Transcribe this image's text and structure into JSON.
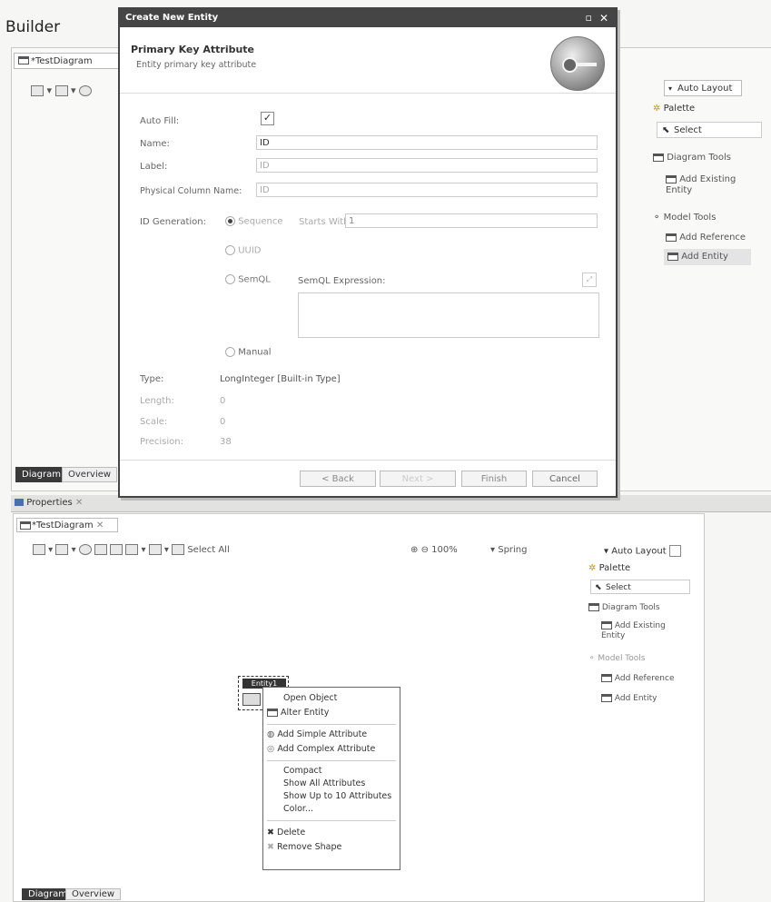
{
  "app": {
    "title": "Builder"
  },
  "upper_editor": {
    "tab_label": "*TestDiagram",
    "bottom_tabs": [
      "Diagram",
      "Overview"
    ],
    "palette": {
      "auto_layout": "Auto Layout",
      "header": "Palette",
      "select": "Select",
      "diagram_tools": "Diagram Tools",
      "add_existing_entity": "Add Existing Entity",
      "model_tools": "Model Tools",
      "add_reference": "Add Reference",
      "add_entity": "Add Entity"
    }
  },
  "properties_tab": {
    "label": "Properties"
  },
  "dialog": {
    "title": "Create New Entity",
    "header_title": "Primary Key Attribute",
    "header_subtitle": "Entity primary key attribute",
    "auto_fill_label": "Auto Fill:",
    "auto_fill_checked": true,
    "name_label": "Name:",
    "name_value": "ID",
    "label_label": "Label:",
    "label_value": "ID",
    "physical_label": "Physical Column Name:",
    "physical_value": "ID",
    "id_generation_label": "ID Generation:",
    "options": {
      "sequence": "Sequence",
      "starts_with_label": "Starts With:",
      "starts_with_value": "1",
      "uuid": "UUID",
      "semql": "SemQL",
      "semql_expression_label": "SemQL Expression:",
      "manual": "Manual"
    },
    "type_label": "Type:",
    "type_value": "LongInteger [Built-in Type]",
    "length_label": "Length:",
    "length_value": "0",
    "scale_label": "Scale:",
    "scale_value": "0",
    "precision_label": "Precision:",
    "precision_value": "38",
    "buttons": {
      "back": "< Back",
      "next": "Next >",
      "finish": "Finish",
      "cancel": "Cancel"
    }
  },
  "lower_editor": {
    "tab_label": "*TestDiagram",
    "toolbar": {
      "select_all": "Select All",
      "zoom": "100%",
      "layout": "Spring",
      "auto_layout": "Auto Layout"
    },
    "palette": {
      "header": "Palette",
      "select": "Select",
      "diagram_tools": "Diagram Tools",
      "add_existing_entity": "Add Existing Entity",
      "model_tools": "Model Tools",
      "add_reference": "Add Reference",
      "add_entity": "Add Entity"
    },
    "entity_shape_label": "Entity1",
    "bottom_tabs": [
      "Diagram",
      "Overview"
    ]
  },
  "context_menu": {
    "items": [
      "Open Object",
      "Alter Entity",
      "Add Simple Attribute",
      "Add Complex Attribute",
      "Compact",
      "Show All Attributes",
      "Show Up to 10 Attributes",
      "Color...",
      "Delete",
      "Remove Shape"
    ]
  }
}
